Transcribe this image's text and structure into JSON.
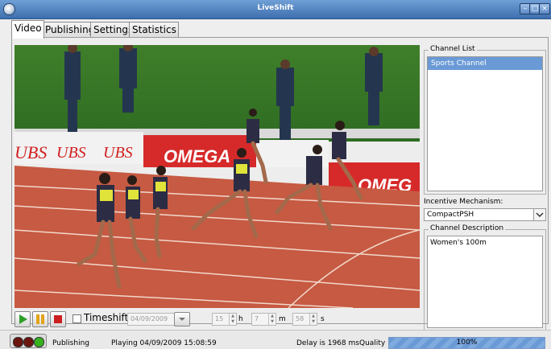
{
  "window": {
    "title": "LiveShift"
  },
  "tabs": [
    {
      "label": "Video",
      "active": true
    },
    {
      "label": "Publishing",
      "active": false
    },
    {
      "label": "Settings",
      "active": false
    },
    {
      "label": "Statistics",
      "active": false
    }
  ],
  "video": {
    "banner_ubs": "UBS",
    "banner_omega": "OMEGA",
    "banner_omega_right": "OMEG"
  },
  "controls": {
    "timeshift_label": "Timeshift",
    "timeshift_checked": false,
    "date_value": "04/09/2009",
    "hours_value": "15",
    "hours_unit": "h",
    "minutes_value": "7",
    "minutes_unit": "m",
    "seconds_value": "58",
    "seconds_unit": "s"
  },
  "sidebar": {
    "channel_list_label": "Channel List",
    "channels": [
      "Sports Channel"
    ],
    "incentive_label": "Incentive Mechanism:",
    "incentive_value": "CompactPSH",
    "description_label": "Channel Description",
    "description_text": "Women's 100m"
  },
  "statusbar": {
    "publishing_label": "Publishing",
    "playing_text": "Playing 04/09/2009 15:08:59",
    "delay_text": "Delay is 1968 ms",
    "quality_label": "Quality",
    "quality_value": "100%",
    "quality_fraction": 1.0
  },
  "colors": {
    "accent": "#6a9ad6",
    "track": "#c65a42",
    "status_light_1": "#6b1410",
    "status_light_2": "#6b1410",
    "status_light_3": "#35b21e"
  }
}
